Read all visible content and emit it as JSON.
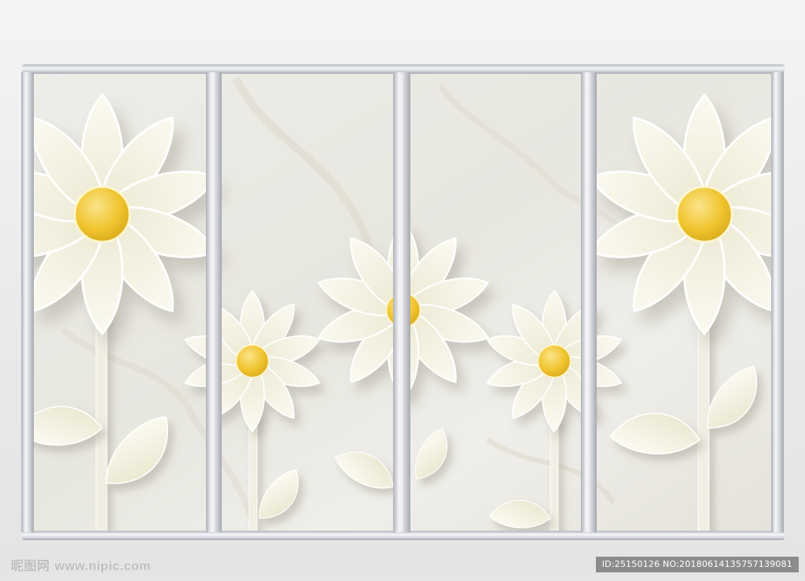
{
  "scene": {
    "subject": "white paper daisies",
    "background_color": "#eeeeef",
    "marble_color": "#ecebe6",
    "bar_color": "#c9ccd3",
    "petal_color": "#f5f3e1",
    "center_color": "#f2cb3a",
    "panel_count": 4
  },
  "watermark": {
    "site_cn": "昵图网",
    "site_url": "www.nipic.com",
    "image_id": "ID:25150126 NO:20180614135757139081"
  }
}
